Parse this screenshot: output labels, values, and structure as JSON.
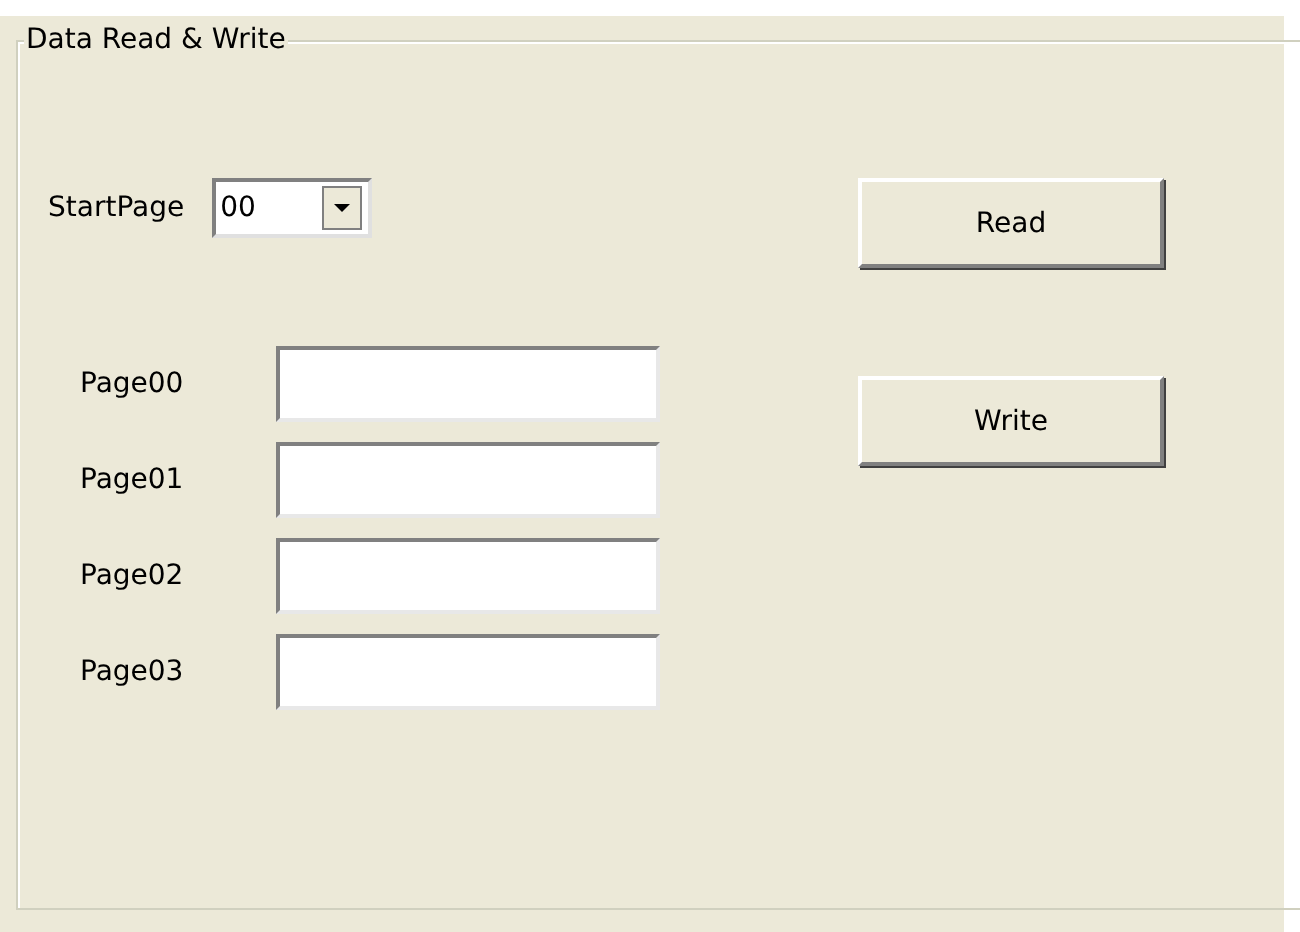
{
  "group": {
    "title": "Data Read & Write"
  },
  "start_page": {
    "label": "StartPage",
    "value": "00"
  },
  "pages": [
    {
      "label": "Page00"
    },
    {
      "label": "Page01"
    },
    {
      "label": "Page02"
    },
    {
      "label": "Page03"
    }
  ],
  "buttons": [
    {
      "label": "Read"
    },
    {
      "label": "Write"
    }
  ]
}
